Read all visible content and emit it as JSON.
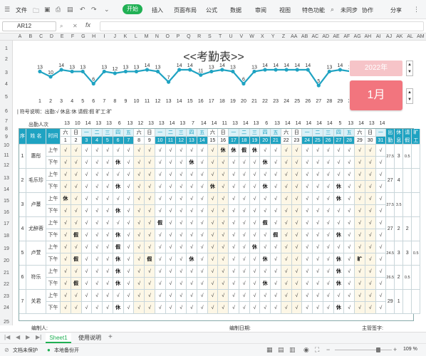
{
  "toolbar": {
    "file": "文件",
    "menus": [
      "开始",
      "插入",
      "页面布局",
      "公式",
      "数据",
      "审阅",
      "视图",
      "特色功能"
    ],
    "cloud": "未同步",
    "collab": "协作",
    "share": "分享"
  },
  "formula_bar": {
    "cell_ref": "AR12",
    "fx": "fx"
  },
  "columns": [
    "A",
    "B",
    "C",
    "D",
    "E",
    "F",
    "G",
    "H",
    "I",
    "J",
    "K",
    "L",
    "M",
    "N",
    "O",
    "P",
    "Q",
    "R",
    "S",
    "T",
    "U",
    "V",
    "W",
    "X",
    "Y",
    "Z",
    "AA",
    "AB",
    "AC",
    "AD",
    "AE",
    "AF",
    "AG",
    "AH",
    "AI",
    "AJ",
    "AK",
    "AL",
    "AM"
  ],
  "rows": [
    "1",
    "2",
    "3",
    "4",
    "5",
    "6",
    "7",
    "8",
    "9",
    "10",
    "11",
    "12",
    "13",
    "14",
    "15",
    "16",
    "17",
    "18",
    "19",
    "20",
    "21",
    "22",
    "23",
    "24",
    "25"
  ],
  "sheet_title": "<<考勤表>>",
  "year": "2022年",
  "month": "1月",
  "legend": "| 符号说明：出勤:√     休息:休     请假:假      旷工:旷",
  "chart_data": {
    "type": "line",
    "x": [
      1,
      2,
      3,
      4,
      5,
      6,
      7,
      8,
      9,
      10,
      11,
      12,
      13,
      14,
      15,
      16,
      17,
      18,
      19,
      20,
      21,
      22,
      23,
      24,
      25,
      26,
      27,
      28,
      29,
      30,
      31
    ],
    "values": [
      13,
      10,
      14,
      13,
      13,
      6,
      13,
      12,
      13,
      13,
      14,
      13,
      7,
      14,
      14,
      11,
      13,
      14,
      13,
      6,
      13,
      14,
      14,
      14,
      14,
      14,
      5,
      13,
      14,
      13,
      14
    ],
    "xlim": [
      1,
      31
    ]
  },
  "totals_label": "出勤人次",
  "totals": [
    "13",
    "10",
    "14",
    "13",
    "13",
    "6",
    "13",
    "12",
    "13",
    "13",
    "14",
    "13",
    "7",
    "14",
    "14",
    "11",
    "13",
    "14",
    "13",
    "6",
    "13",
    "14",
    "14",
    "14",
    "14",
    "14",
    "5",
    "13",
    "14",
    "13",
    "14"
  ],
  "header": {
    "seq": "序",
    "name": "姓 名",
    "time": "时间",
    "weekdays": [
      "六",
      "日",
      "一",
      "二",
      "三",
      "四",
      "五",
      "六",
      "日",
      "一",
      "二",
      "三",
      "四",
      "五",
      "六",
      "日",
      "一",
      "二",
      "三",
      "四",
      "五",
      "六",
      "日",
      "一",
      "二",
      "三",
      "四",
      "五",
      "六",
      "日",
      "一"
    ],
    "days": [
      "1",
      "2",
      "3",
      "4",
      "5",
      "6",
      "7",
      "8",
      "9",
      "10",
      "11",
      "12",
      "13",
      "14",
      "15",
      "16",
      "17",
      "18",
      "19",
      "20",
      "21",
      "22",
      "23",
      "24",
      "25",
      "26",
      "27",
      "28",
      "29",
      "30",
      "31"
    ],
    "summary": [
      "出勤",
      "休息",
      "请假",
      "旷工"
    ]
  },
  "employees": [
    {
      "seq": "1",
      "name": "惠彤",
      "am": [
        "√",
        "√",
        "√",
        "√",
        "√",
        "√",
        "√",
        "√",
        "√",
        "√",
        "√",
        "√",
        "√",
        "√",
        "√",
        "休",
        "休",
        "假",
        "休",
        "√",
        "√",
        "√",
        "√",
        "√",
        "√",
        "√",
        "√",
        "√",
        "√",
        "√",
        "√"
      ],
      "pm": [
        "√",
        "√",
        "√",
        "√",
        "√",
        "休",
        "√",
        "√",
        "√",
        "√",
        "√",
        "√",
        "休",
        "√",
        "√",
        "√",
        "√",
        "√",
        "√",
        "休",
        "√",
        "√",
        "√",
        "√",
        "√",
        "√",
        "√",
        "√",
        "√",
        "√",
        "√"
      ],
      "stats": [
        "27.5",
        "3",
        "0.5",
        ""
      ]
    },
    {
      "seq": "2",
      "name": "毛乐珍",
      "am": [
        "√",
        "√",
        "√",
        "√",
        "√",
        "√",
        "√",
        "√",
        "√",
        "√",
        "√",
        "√",
        "√",
        "√",
        "√",
        "√",
        "√",
        "√",
        "√",
        "√",
        "√",
        "√",
        "√",
        "√",
        "√",
        "√",
        "√",
        "√",
        "√",
        "√",
        "√"
      ],
      "pm": [
        "√",
        "√",
        "√",
        "√",
        "√",
        "休",
        "√",
        "√",
        "√",
        "√",
        "√",
        "√",
        "√",
        "√",
        "休",
        "√",
        "√",
        "√",
        "√",
        "休",
        "√",
        "√",
        "√",
        "√",
        "√",
        "√",
        "休",
        "√",
        "√",
        "√",
        "√"
      ],
      "stats": [
        "27",
        "4",
        "",
        ""
      ]
    },
    {
      "seq": "3",
      "name": "卢蔓",
      "am": [
        "休",
        "√",
        "√",
        "√",
        "√",
        "√",
        "√",
        "√",
        "√",
        "√",
        "√",
        "√",
        "√",
        "√",
        "√",
        "√",
        "√",
        "√",
        "√",
        "√",
        "√",
        "√",
        "√",
        "√",
        "√",
        "√",
        "休",
        "√",
        "√",
        "√",
        "√"
      ],
      "pm": [
        "√",
        "√",
        "√",
        "√",
        "√",
        "休",
        "√",
        "√",
        "√",
        "√",
        "√",
        "√",
        "√",
        "√",
        "√",
        "√",
        "√",
        "√",
        "√",
        "√",
        "√",
        "√",
        "√",
        "√",
        "√",
        "√",
        "√",
        "√",
        "√",
        "√",
        "√"
      ],
      "stats": [
        "27.5",
        "3.5",
        "",
        ""
      ]
    },
    {
      "seq": "4",
      "name": "尤醉蓉",
      "am": [
        "√",
        "√",
        "√",
        "√",
        "√",
        "√",
        "√",
        "√",
        "√",
        "假",
        "√",
        "√",
        "√",
        "√",
        "√",
        "√",
        "√",
        "√",
        "√",
        "假",
        "√",
        "√",
        "√",
        "√",
        "√",
        "√",
        "√",
        "√",
        "√",
        "√",
        "√"
      ],
      "pm": [
        "√",
        "假",
        "√",
        "√",
        "√",
        "休",
        "√",
        "√",
        "√",
        "√",
        "√",
        "√",
        "√",
        "√",
        "√",
        "√",
        "√",
        "√",
        "√",
        "√",
        "假",
        "√",
        "√",
        "√",
        "√",
        "√",
        "休",
        "√",
        "√",
        "√",
        "√"
      ],
      "stats": [
        "27",
        "2",
        "2",
        ""
      ]
    },
    {
      "seq": "5",
      "name": "卢萱",
      "am": [
        "√",
        "√",
        "√",
        "√",
        "√",
        "假",
        "√",
        "√",
        "√",
        "√",
        "√",
        "√",
        "√",
        "√",
        "√",
        "√",
        "√",
        "√",
        "休",
        "√",
        "√",
        "√",
        "√",
        "√",
        "√",
        "√",
        "√",
        "√",
        "√",
        "√",
        "√"
      ],
      "pm": [
        "√",
        "假",
        "√",
        "√",
        "√",
        "休",
        "√",
        "√",
        "假",
        "√",
        "√",
        "√",
        "休",
        "√",
        "√",
        "√",
        "√",
        "√",
        "√",
        "休",
        "√",
        "√",
        "√",
        "√",
        "√",
        "√",
        "休",
        "√",
        "旷",
        "√",
        "√"
      ],
      "stats": [
        "24.5",
        "3",
        "3",
        "0.5"
      ]
    },
    {
      "seq": "6",
      "name": "符乐",
      "am": [
        "√",
        "√",
        "√",
        "√",
        "√",
        "休",
        "√",
        "√",
        "√",
        "√",
        "√",
        "√",
        "√",
        "√",
        "√",
        "√",
        "√",
        "√",
        "√",
        "√",
        "√",
        "√",
        "√",
        "√",
        "√",
        "√",
        "休",
        "√",
        "√",
        "√",
        "√"
      ],
      "pm": [
        "√",
        "假",
        "√",
        "√",
        "√",
        "休",
        "√",
        "√",
        "√",
        "√",
        "√",
        "√",
        "√",
        "√",
        "√",
        "√",
        "√",
        "√",
        "√",
        "休",
        "√",
        "√",
        "√",
        "√",
        "√",
        "√",
        "休",
        "√",
        "√",
        "√",
        "√"
      ],
      "stats": [
        "26.5",
        "2",
        "0.5",
        ""
      ]
    },
    {
      "seq": "7",
      "name": "关君",
      "am": [
        "√",
        "√",
        "√",
        "√",
        "√",
        "√",
        "√",
        "√",
        "√",
        "√",
        "√",
        "√",
        "√",
        "√",
        "√",
        "√",
        "√",
        "√",
        "√",
        "√",
        "√",
        "√",
        "√",
        "√",
        "√",
        "√",
        "√",
        "√",
        "√",
        "√",
        "√"
      ],
      "pm": [
        "√",
        "√",
        "√",
        "√",
        "√",
        "休",
        "√",
        "√",
        "√",
        "√",
        "√",
        "√",
        "√",
        "√",
        "√",
        "√",
        "√",
        "√",
        "√",
        "√",
        "√",
        "√",
        "√",
        "√",
        "√",
        "√",
        "休",
        "√",
        "√",
        "√",
        "√"
      ],
      "stats": [
        "29",
        "1",
        "",
        ""
      ]
    }
  ],
  "am_label": "上午",
  "pm_label": "下午",
  "footer": {
    "maker": "编制人:",
    "date": "编制日期:",
    "signature": "主管签字:"
  },
  "sheets": [
    "Sheet1",
    "使用说明"
  ],
  "status": {
    "protect": "文档未保护",
    "backup": "本地备份开",
    "zoom": "109 %"
  },
  "colors": {
    "header_teal": "#1fa3c2",
    "header_light": "#daf1f8",
    "weekend_fill": "#fdf7e6",
    "accent_green": "#20b054",
    "month_red": "#f2757e",
    "year_pink": "#f6c4c8"
  }
}
